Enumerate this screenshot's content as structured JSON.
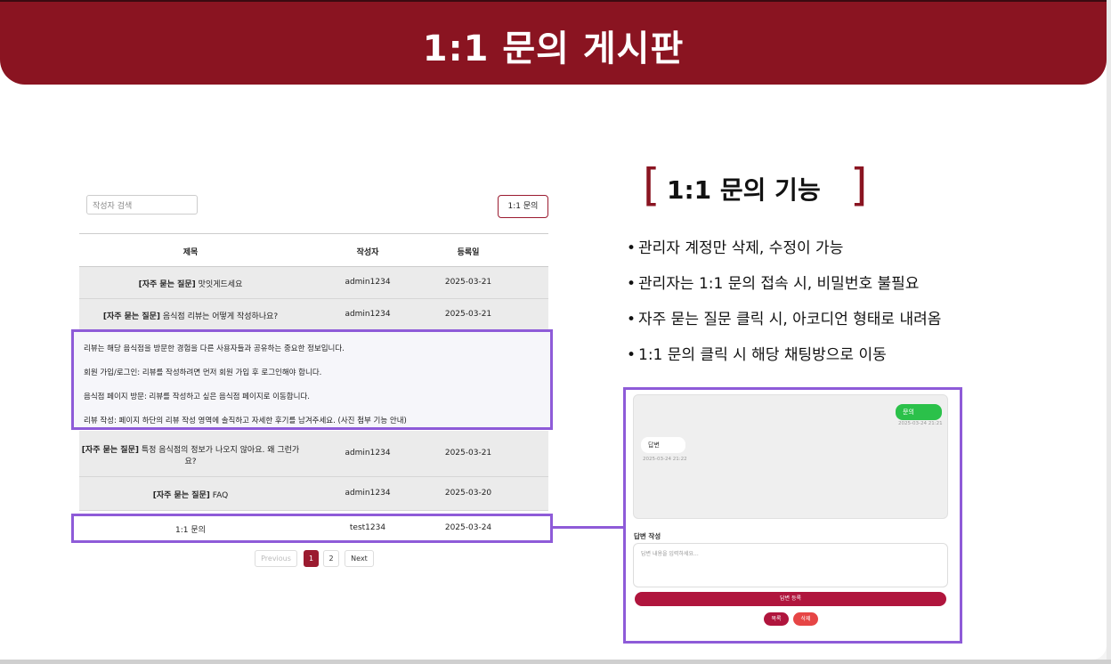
{
  "header": {
    "title": "1:1 문의 게시판"
  },
  "board": {
    "search_placeholder": "작성자 검색",
    "inquiry_button": "1:1 문의",
    "columns": {
      "title": "제목",
      "author": "작성자",
      "date": "등록일"
    },
    "rows": [
      {
        "tag": "[자주 묻는 질문]",
        "title": " 맛잇게드세요",
        "author": "admin1234",
        "date": "2025-03-21"
      },
      {
        "tag": "[자주 묻는 질문]",
        "title": " 음식점 리뷰는 어떻게 작성하나요?",
        "author": "admin1234",
        "date": "2025-03-21"
      },
      {
        "tag": "[자주 묻는 질문]",
        "title": " 특정 음식점의 정보가 나오지 않아요. 왜 그런가",
        "title_line2": "요?",
        "author": "admin1234",
        "date": "2025-03-21"
      },
      {
        "tag": "[자주 묻는 질문]",
        "title": " FAQ",
        "author": "admin1234",
        "date": "2025-03-20"
      },
      {
        "tag": "",
        "title": "1:1 문의",
        "author": "test1234",
        "date": "2025-03-24"
      }
    ],
    "accordion": [
      "리뷰는 해당 음식점을 방문한 경험을 다른 사용자들과 공유하는 중요한 정보입니다.",
      "회원 가입/로그인: 리뷰를 작성하려면 먼저 회원 가입 후 로그인해야 합니다.",
      "음식점 페이지 방문: 리뷰를 작성하고 싶은 음식점 페이지로 이동합니다.",
      "리뷰 작성: 페이지 하단의 리뷰 작성 영역에 솔직하고 자세한 후기를 남겨주세요. (사진 첨부 기능 안내)"
    ],
    "pagination": {
      "previous": "Previous",
      "pages": [
        "1",
        "2"
      ],
      "current": "1",
      "next": "Next"
    }
  },
  "features": {
    "title": "1:1 문의 기능",
    "bracket_open": "[",
    "bracket_close": "]",
    "bullet_symbol": "•",
    "items": [
      "관리자 계정만 삭제, 수정이 가능",
      "관리자는 1:1 문의 접속 시, 비밀번호 불필요",
      "자주 묻는 질문 클릭 시, 아코디언 형태로 내려옴",
      "1:1 문의 클릭 시 해당 채팅방으로 이동"
    ]
  },
  "chat": {
    "my_message": "문의",
    "my_time": "2025-03-24 21:21",
    "other_message": "답변",
    "other_time": "2025-03-24 21:22",
    "reply_label": "답변 작성",
    "reply_placeholder": "답변 내용을 입력하세요...",
    "register_button": "답변 등록",
    "list_button": "목록",
    "delete_button": "삭제"
  },
  "colors": {
    "brand": "#8a1421",
    "highlight": "#8e5bd8",
    "chat_green": "#2bc14a"
  }
}
